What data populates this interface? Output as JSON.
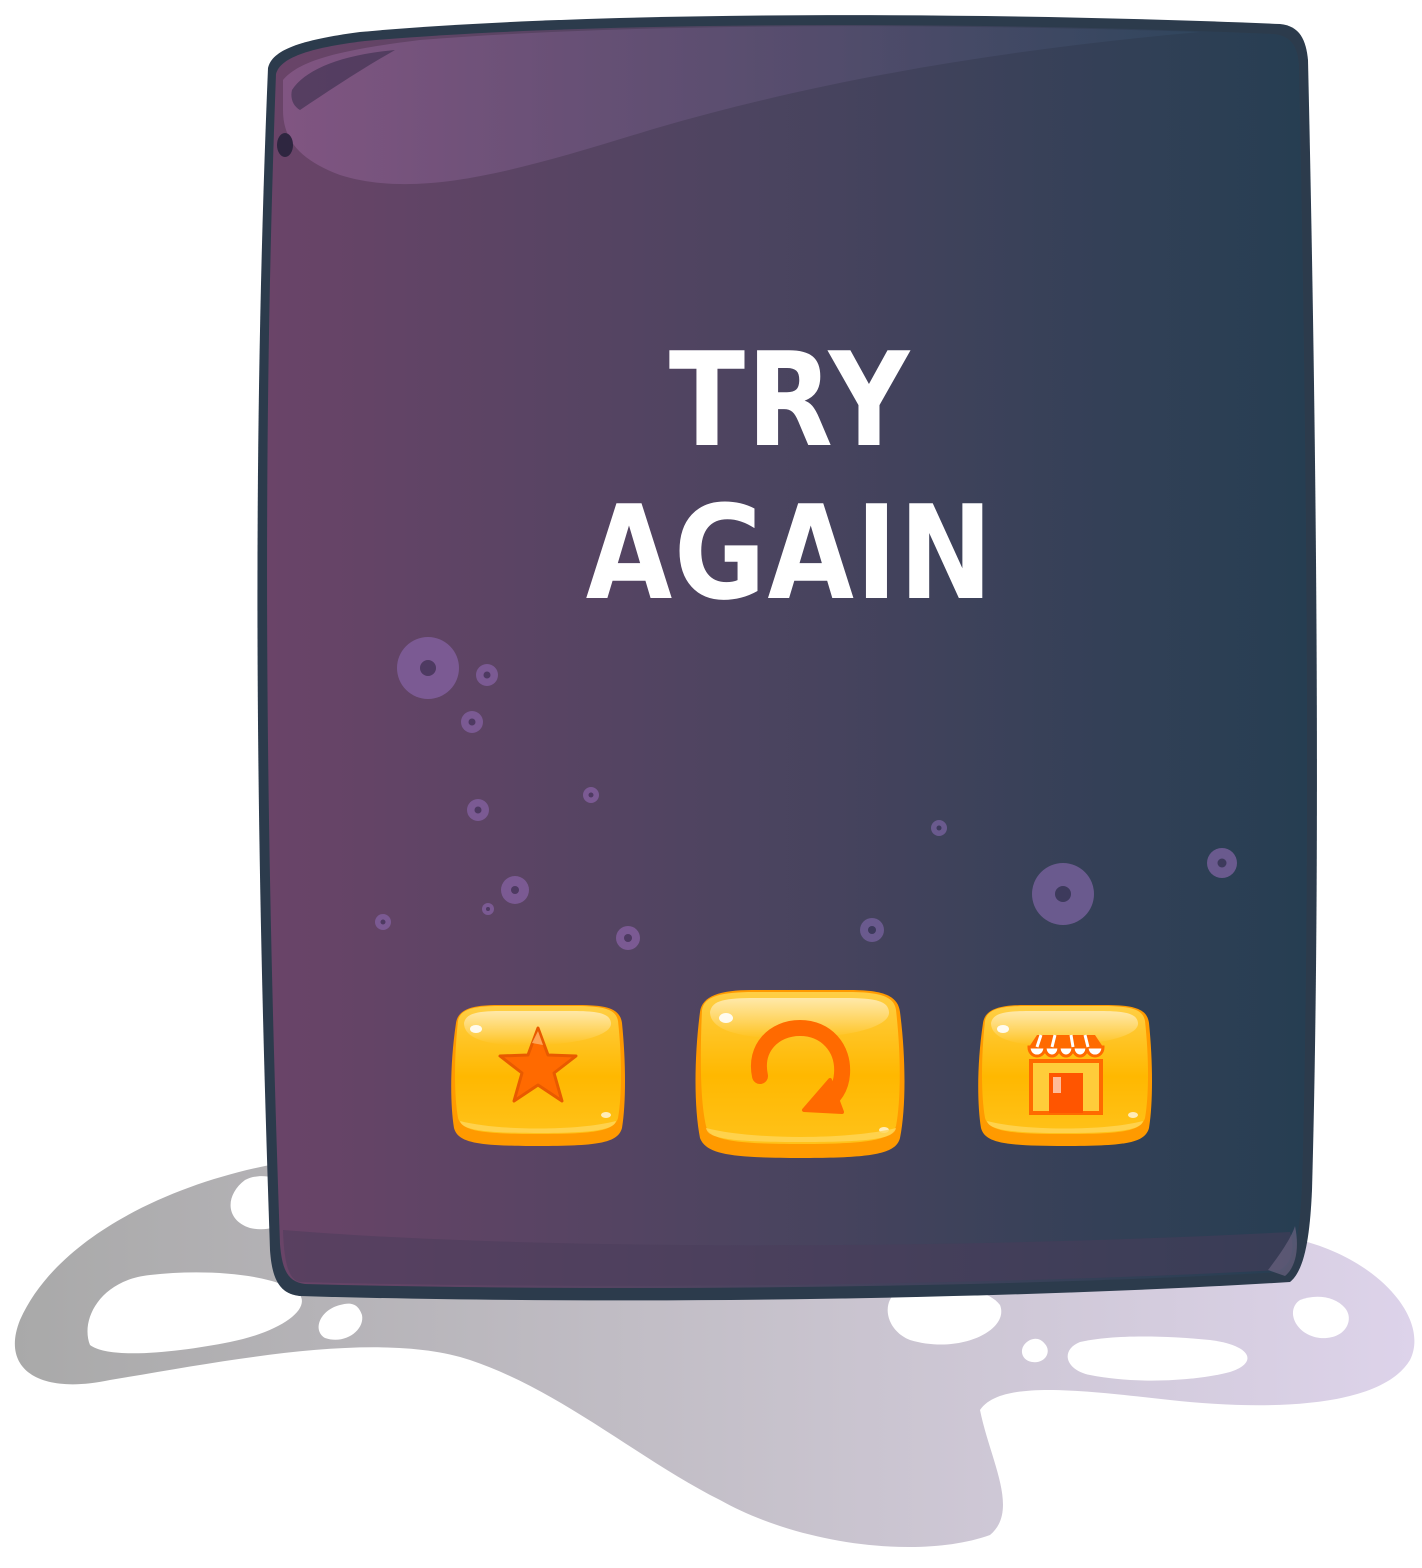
{
  "screen": "try-again-popup",
  "title": {
    "line1": "TRY",
    "line2": "AGAIN"
  },
  "buttons": [
    {
      "name": "star-button",
      "icon": "star-icon"
    },
    {
      "name": "replay-button",
      "icon": "replay-icon"
    },
    {
      "name": "shop-button",
      "icon": "shop-icon"
    }
  ],
  "colors": {
    "panel_left": "#6a4468",
    "panel_right": "#263e52",
    "button_top": "#ffd24a",
    "button_bottom": "#ffae00",
    "button_base": "#ff9a00",
    "icon_fill": "#ff6a00",
    "text": "#ffffff",
    "shadow_left": "#a8a8a8",
    "shadow_right": "#d8d0e6"
  }
}
